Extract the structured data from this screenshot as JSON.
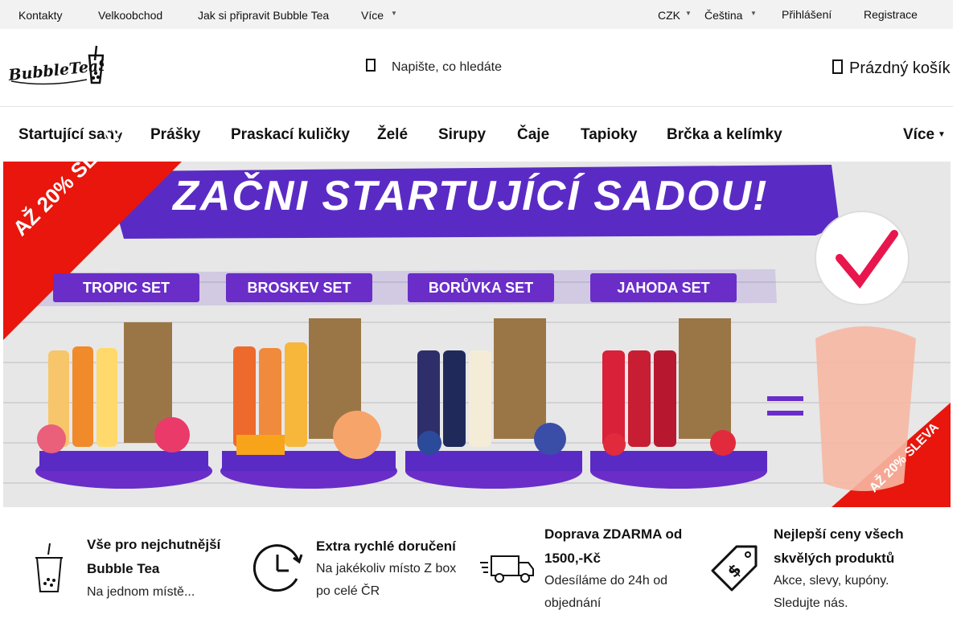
{
  "topbar": {
    "links": [
      "Kontakty",
      "Velkoobchod",
      "Jak si připravit Bubble Tea",
      "Více"
    ],
    "currency": "CZK",
    "language": "Čeština",
    "login": "Přihlášení",
    "register": "Registrace"
  },
  "header": {
    "logo_text": "BubbleTeaShop",
    "search_placeholder": "Napište, co hledáte",
    "cart_label": "Prázdný košík"
  },
  "nav": {
    "items": [
      "Startující sady",
      "Prášky",
      "Praskací kuličky",
      "Želé",
      "Sirupy",
      "Čaje",
      "Tapioky",
      "Brčka a kelímky"
    ],
    "more": "Více"
  },
  "banner": {
    "headline": "ZAČNI STARTUJÍCÍ SADOU!",
    "ribbon": "AŽ 20% SLEVA",
    "sets": [
      "TROPIC SET",
      "BROSKEV SET",
      "BORŮVKA SET",
      "JAHODA SET"
    ],
    "colors": {
      "purple": "#5a2bc4",
      "red": "#e8160c"
    }
  },
  "features": [
    {
      "icon": "bubble-tea-cup-icon",
      "title": "Vše pro nejchutnější Bubble Tea",
      "subtitle": "Na jednom místě..."
    },
    {
      "icon": "clock-icon",
      "title": "Extra rychlé doručení",
      "subtitle": "Na jakékoliv místo Z box po celé ČR"
    },
    {
      "icon": "delivery-truck-icon",
      "title": "Doprava ZDARMA od 1500,-Kč",
      "subtitle": "Odesíláme do 24h od objednání"
    },
    {
      "icon": "price-tag-icon",
      "title": "Nejlepší ceny všech skvělých produktů",
      "subtitle": "Akce, slevy, kupóny. Sledujte nás."
    }
  ]
}
